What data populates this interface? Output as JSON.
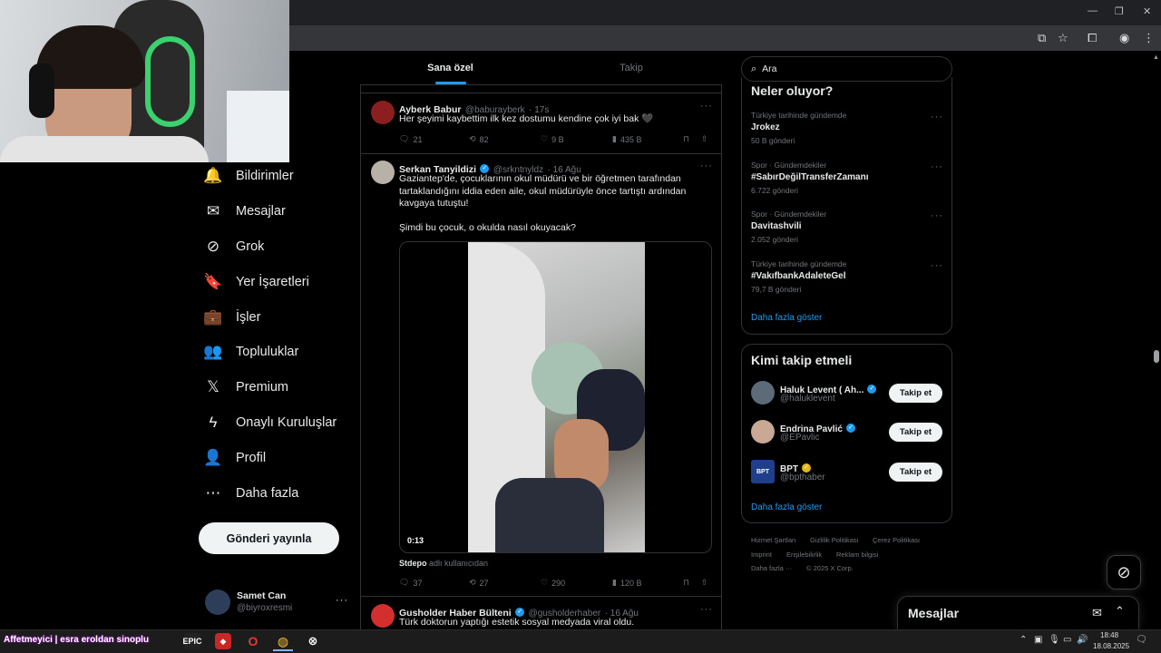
{
  "colors": {
    "accent": "#1d9bf0",
    "verified_gold": "#e2b719",
    "background": "#000000",
    "border": "#2f3336",
    "muted": "#71767b"
  },
  "window_controls": {
    "minimize": "—",
    "restore": "❐",
    "close": "✕"
  },
  "nav": {
    "items": [
      {
        "label": "Bildirimler",
        "icon": "bell-icon",
        "glyph": "🔔"
      },
      {
        "label": "Mesajlar",
        "icon": "envelope-icon",
        "glyph": "✉"
      },
      {
        "label": "Grok",
        "icon": "grok-icon",
        "glyph": "⊘"
      },
      {
        "label": "Yer İşaretleri",
        "icon": "bookmark-icon",
        "glyph": "🔖"
      },
      {
        "label": "İşler",
        "icon": "briefcase-icon",
        "glyph": "💼"
      },
      {
        "label": "Topluluklar",
        "icon": "people-icon",
        "glyph": "👥"
      },
      {
        "label": "Premium",
        "icon": "x-logo-icon",
        "glyph": "𝕏"
      },
      {
        "label": "Onaylı Kuruluşlar",
        "icon": "lightning-icon",
        "glyph": "ϟ"
      },
      {
        "label": "Profil",
        "icon": "person-icon",
        "glyph": "👤"
      },
      {
        "label": "Daha fazla",
        "icon": "more-circle-icon",
        "glyph": "⋯"
      }
    ],
    "post_button": "Gönderi yayınla",
    "account": {
      "name": "Samet Can",
      "handle": "@biyroxresmi",
      "more": "···"
    }
  },
  "tabs": {
    "for_you": "Sana özel",
    "following": "Takip"
  },
  "tweets": [
    {
      "name": "Ayberk Babur",
      "handle": "@baburayberk",
      "time": "· 17s",
      "text": "Her şeyimi kaybettim ilk kez dostumu kendine çok iyi bak 🖤",
      "replies": "21",
      "reposts": "82",
      "likes": "9 B",
      "views": "435 B"
    },
    {
      "name": "Serkan Tanyildizi",
      "handle": "@srkntnyldz",
      "time": "· 16 Ağu",
      "text": "Gaziantep'de, çocuklarının okul müdürü ve bir öğretmen tarafından tartaklandığını iddia eden aile, okul müdürüyle önce tartıştı ardından kavgaya tutuştu!",
      "text2": "Şimdi bu çocuk, o okulda nasıl okuyacak?",
      "video_time": "0:13",
      "source_user": "Stdepo",
      "source_suffix": "adlı kullanıcıdan",
      "replies": "37",
      "reposts": "27",
      "likes": "290",
      "views": "120 B"
    },
    {
      "name": "Gusholder Haber Bülteni",
      "handle": "@gusholderhaber",
      "time": "· 16 Ağu",
      "text": "Türk doktorun yaptığı estetik sosyal medyada viral oldu."
    }
  ],
  "search": {
    "placeholder": "Ara"
  },
  "trends": {
    "title": "Neler oluyor?",
    "items": [
      {
        "category": "Türkiye tarihinde gündemde",
        "title": "Jrokez",
        "count": "50 B gönderi"
      },
      {
        "category": "Spor · Gündemdekiler",
        "title": "#SabırDeğilTransferZamanı",
        "count": "6.722 gönderi"
      },
      {
        "category": "Spor · Gündemdekiler",
        "title": "Davitashvili",
        "count": "2.052 gönderi"
      },
      {
        "category": "Türkiye tarihinde gündemde",
        "title": "#VakıfbankAdaleteGel",
        "count": "79,7 B gönderi"
      }
    ],
    "show_more": "Daha fazla göster"
  },
  "who_to_follow": {
    "title": "Kimi takip etmeli",
    "items": [
      {
        "name": "Haluk Levent ( Ah...",
        "handle": "@haluklevent",
        "badge": "blue"
      },
      {
        "name": "Endrina Pavlić",
        "handle": "@EPavlic",
        "badge": "blue"
      },
      {
        "name": "BPT",
        "handle": "@bpthaber",
        "badge": "gold",
        "avatar_text": "BPT"
      }
    ],
    "follow_label": "Takip et",
    "show_more": "Daha fazla göster"
  },
  "footer": {
    "links": [
      "Hizmet Şartları",
      "Gizlilik Politikası",
      "Çerez Politikası",
      "Imprint",
      "Erişilebilirlik",
      "Reklam bilgisi",
      "Daha fazla ···"
    ],
    "copyright": "© 2025 X Corp."
  },
  "messages_drawer": {
    "title": "Mesajlar"
  },
  "taskbar": {
    "marquee": "Affetmeyici | esra eroldan sinoplu",
    "time": "18:48",
    "date": "18.08.2025"
  }
}
